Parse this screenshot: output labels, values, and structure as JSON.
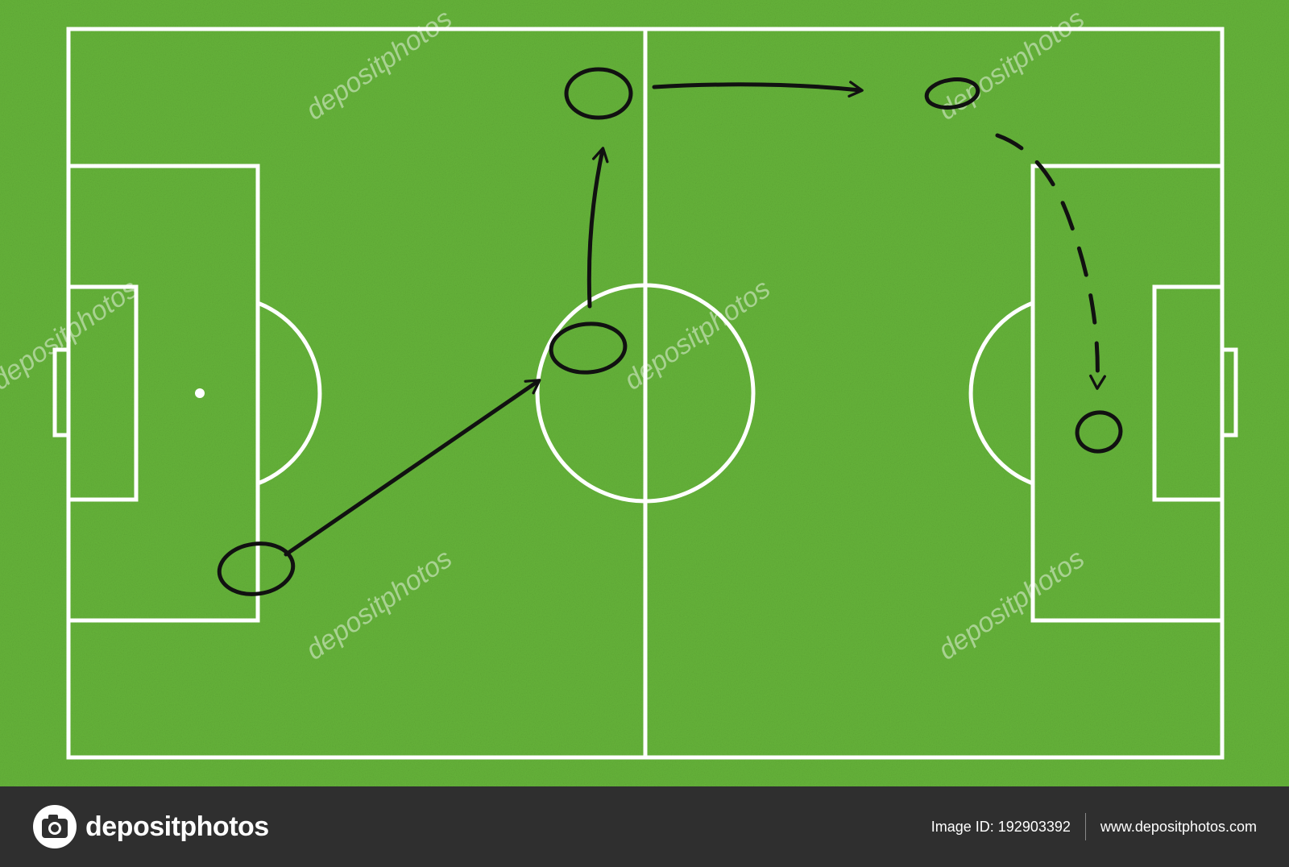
{
  "colors": {
    "grass": "#66b43a",
    "grass_dark": "#4f9a2a",
    "line": "#ffffff",
    "ink": "#111111",
    "footer": "#2f2f2f"
  },
  "watermark": {
    "text": "depositphotos"
  },
  "players": [
    {
      "id": "p1"
    },
    {
      "id": "p2"
    },
    {
      "id": "p3"
    },
    {
      "id": "p4"
    },
    {
      "id": "p5"
    }
  ],
  "footer": {
    "brand_icon": "camera-icon",
    "brand_name": "depositphotos",
    "image_id_label": "Image ID: 192903392",
    "site_url": "www.depositphotos.com"
  }
}
